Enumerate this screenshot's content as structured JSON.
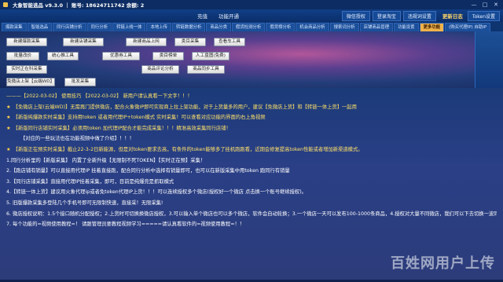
{
  "window": {
    "title": "大象智能选品 v9.3.0 ｜ 账号: 18624711742 余额: 2",
    "ctrls": [
      "—",
      "□",
      "✕"
    ]
  },
  "menubar": {
    "items": [
      "充值",
      "功能开通"
    ],
    "right_items": [
      "微信授权",
      "登录淘宝",
      "违规词设置",
      "Token设置"
    ],
    "update": "更新日志"
  },
  "tabs": [
    "爆款采集",
    "智能选品",
    "同行店铺分析",
    "同行分析",
    "转链上线一体",
    "本地上传",
    "转链数据分析",
    "商品分类",
    "假货检测分析",
    "假货榜分析",
    "机会商品分析",
    "搜索词分析",
    "店铺商品管理",
    "功能设置",
    "更多功能",
    "(购买代理IP) 自助IP"
  ],
  "active_tab_index": 14,
  "toolbar": {
    "buttons": [
      "新建爆款采集",
      "新建店铺采集",
      "新建商品上网",
      "类目采集",
      "查看车工具",
      "批量改价",
      "统心推工具",
      "优惠券工具",
      "类目榜单",
      "人工盘图(免费)",
      "实时正在科采集",
      "商品评论分析",
      "商品同步工具",
      "免微店上架【云端WD】",
      "批发采集"
    ]
  },
  "content": {
    "lines": [
      {
        "kind": "dash",
        "text": "———【2022-03-02】 使用技巧 【2022-03-02】 新用户请认真看一下文字！！！"
      },
      {
        "kind": "star",
        "text": "【免微店上架(云端WD)】无需再门提供微店，配合火象微IP即可实现商上拉上架功能，对于上货量多的用户，建议【免微店上货】和【转链一体上货】一起用"
      },
      {
        "kind": "star",
        "text": "【新版纯爆款实时采集】支持用token 或者用代理IP+token模式 实时采集！可以查看对应功能的界面的右上角视频"
      },
      {
        "kind": "star",
        "text": "【新版同行店铺实时采集】必须用token 加代理IP配合才能完成采集！！！精准高效采集同行店铺！"
      },
      {
        "kind": "plain",
        "text": "【对应的一些玩法也在功能视频中做了介绍】！！！"
      },
      {
        "kind": "star",
        "text": "【新版正在预实时采集】截止22-3-2日新能源，但是对token要求去高，有条件的token能够多了挂机跑跑看，近期会修复提高token性能或者增加新渠道模式。"
      },
      {
        "kind": "num",
        "text": "1.同行分析里的【新版采集】 内置了全新升级【无限制不死TOKEN】【实时正在预】采集！"
      },
      {
        "kind": "num",
        "text": "2.【跑店铺有销量】可以直接用代理IP 挂着直接跑，配合同行分析中选择有销量即可，也可以在新版采集中用token 跑同行有销量"
      },
      {
        "kind": "num",
        "text": "3.【同行店铺采集】直接用代理IP挂着采集，即可，目前是纯爆竞是抓取模式"
      },
      {
        "kind": "num",
        "text": "4.【转链一体上货】建议用火象代理ip或者免token代理IP上货！！！可以连续授权多个微店(授权好一个微店 点击换一个账号继续授权)。"
      },
      {
        "kind": "num",
        "text": "5. 旧版爆款采集多登陆几个手机号即可无限制快速，直接采！无限采集!"
      },
      {
        "kind": "num",
        "text": "6. 微店授权说明：1.5个接口随机分配授权；2.上货时可切换换微店授权，3.可以输入单个微店也可以多个微店，软件会自动轮换；3.一个微店一天可以发布100-1000条商品，4.授权对大量不同微店，我们可以下去切换一波同店授权，如果你的微店性能很差，可以考虑重新注册成有好机率模式多个微店；去另外IP切换账号。"
      },
      {
        "kind": "num",
        "text": "7. 每个功能的=视频使用教程=！ 请跟管理员要教程视频学习=====请认真看软件的=视频使用教程=！！"
      }
    ]
  },
  "watermark": "百姓网用户上传"
}
